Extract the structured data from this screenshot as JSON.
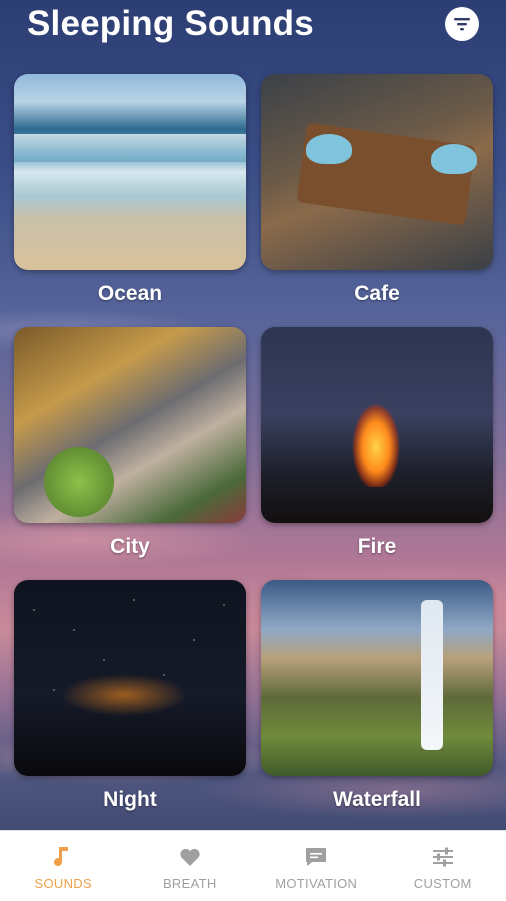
{
  "header": {
    "title": "Sleeping Sounds",
    "filter_icon": "filter-list-icon"
  },
  "colors": {
    "accent": "#f0a04a",
    "inactive": "#a0a0a0"
  },
  "cards": [
    {
      "label": "Ocean"
    },
    {
      "label": "Cafe"
    },
    {
      "label": "City"
    },
    {
      "label": "Fire"
    },
    {
      "label": "Night"
    },
    {
      "label": "Waterfall"
    }
  ],
  "tabs": [
    {
      "label": "SOUNDS",
      "icon": "music-note-icon",
      "active": true
    },
    {
      "label": "BREATH",
      "icon": "heart-icon",
      "active": false
    },
    {
      "label": "MOTIVATION",
      "icon": "chat-bubble-icon",
      "active": false
    },
    {
      "label": "CUSTOM",
      "icon": "sliders-icon",
      "active": false
    }
  ]
}
